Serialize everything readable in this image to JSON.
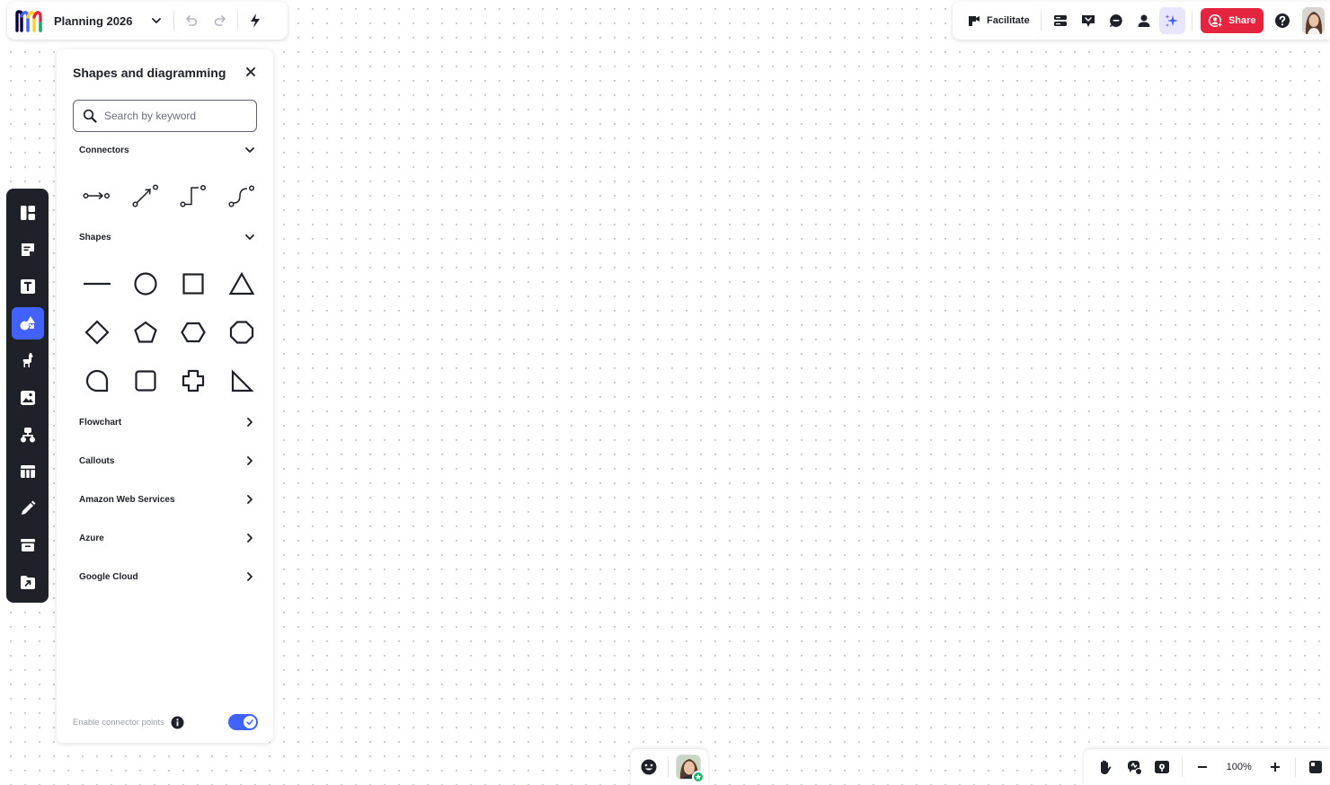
{
  "board": {
    "title": "Planning 2026"
  },
  "topbar": {
    "facilitate_label": "Facilitate",
    "share_label": "Share"
  },
  "panel": {
    "title": "Shapes and diagramming",
    "search_placeholder": "Search by keyword",
    "sections": {
      "connectors": "Connectors",
      "shapes": "Shapes",
      "flowchart": "Flowchart",
      "callouts": "Callouts",
      "aws": "Amazon Web Services",
      "azure": "Azure",
      "google_cloud": "Google Cloud"
    },
    "footer_label": "Enable connector points",
    "connector_points_enabled": true
  },
  "zoom": {
    "level": "100%"
  },
  "colors": {
    "accent": "#4262ff",
    "share": "#e5243f",
    "toolbar_bg": "#1f2129",
    "ai_bg": "#e7e5ff"
  },
  "icons": {
    "left_toolbar": [
      "templates-icon",
      "sticky-note-icon",
      "text-icon",
      "shapes-icon",
      "llama-icon",
      "image-upload-icon",
      "mind-map-icon",
      "table-icon",
      "pen-icon",
      "frame-icon",
      "upload-icon"
    ],
    "topbar": [
      "undo-icon",
      "redo-icon",
      "lightning-icon",
      "facilitate-icon",
      "board-layout-icon",
      "presentation-icon",
      "comment-icon",
      "user-icon",
      "ai-sparkle-icon",
      "help-icon"
    ],
    "bottom": [
      "emoji-icon",
      "hand-icon",
      "reactions-icon",
      "map-icon",
      "zoom-out-icon",
      "zoom-in-icon",
      "minimap-icon"
    ]
  }
}
